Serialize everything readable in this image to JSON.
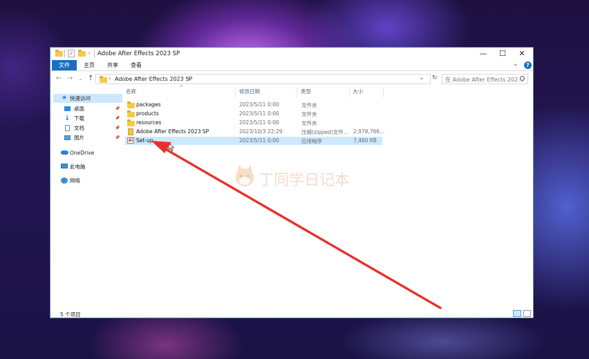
{
  "window": {
    "title": "Adobe After Effects 2023 SP",
    "minimize": "—",
    "maximize": "☐",
    "close": "✕"
  },
  "ribbon": {
    "tabs": [
      "文件",
      "主页",
      "共享",
      "查看"
    ],
    "collapse": "⌄",
    "help": "?"
  },
  "address": {
    "back": "←",
    "forward": "→",
    "recent": "⌄",
    "up": "↑",
    "path": "Adobe After Effects 2023 SP",
    "sep1": "›",
    "sep2": "›",
    "dropdown": "⌄",
    "refresh": "↻",
    "search_placeholder": "在 Adobe After Effects 202..."
  },
  "nav": {
    "quick_access": "快速访问",
    "desktop": "桌面",
    "downloads": "下载",
    "documents": "文档",
    "pictures": "图片",
    "onedrive": "OneDrive",
    "this_pc": "此电脑",
    "network": "网络",
    "pin": "📌"
  },
  "columns": {
    "name": "名称",
    "date": "修改日期",
    "type": "类型",
    "size": "大小",
    "sort_arrow": "^"
  },
  "files": [
    {
      "name": "packages",
      "date": "2023/5/11 0:00",
      "type": "文件夹",
      "size": "",
      "icon": "folder-icon"
    },
    {
      "name": "products",
      "date": "2023/5/11 0:00",
      "type": "文件夹",
      "size": "",
      "icon": "folder-icon"
    },
    {
      "name": "resources",
      "date": "2023/5/11 0:00",
      "type": "文件夹",
      "size": "",
      "icon": "folder-icon"
    },
    {
      "name": "Adobe After Effects 2023 SP",
      "date": "2023/10/3 22:29",
      "type": "压缩(zipped)文件...",
      "size": "2,978,766...",
      "icon": "zip-icon"
    },
    {
      "name": "Set-up",
      "date": "2023/5/11 0:00",
      "type": "应用程序",
      "size": "7,460 KB",
      "icon": "app-icon"
    }
  ],
  "status": {
    "count": "5 个项目"
  },
  "watermark": {
    "text": "丁同学日记本"
  },
  "colors": {
    "accent": "#1b6fc1",
    "selection": "#cce8ff",
    "arrow": "#e8302a"
  }
}
